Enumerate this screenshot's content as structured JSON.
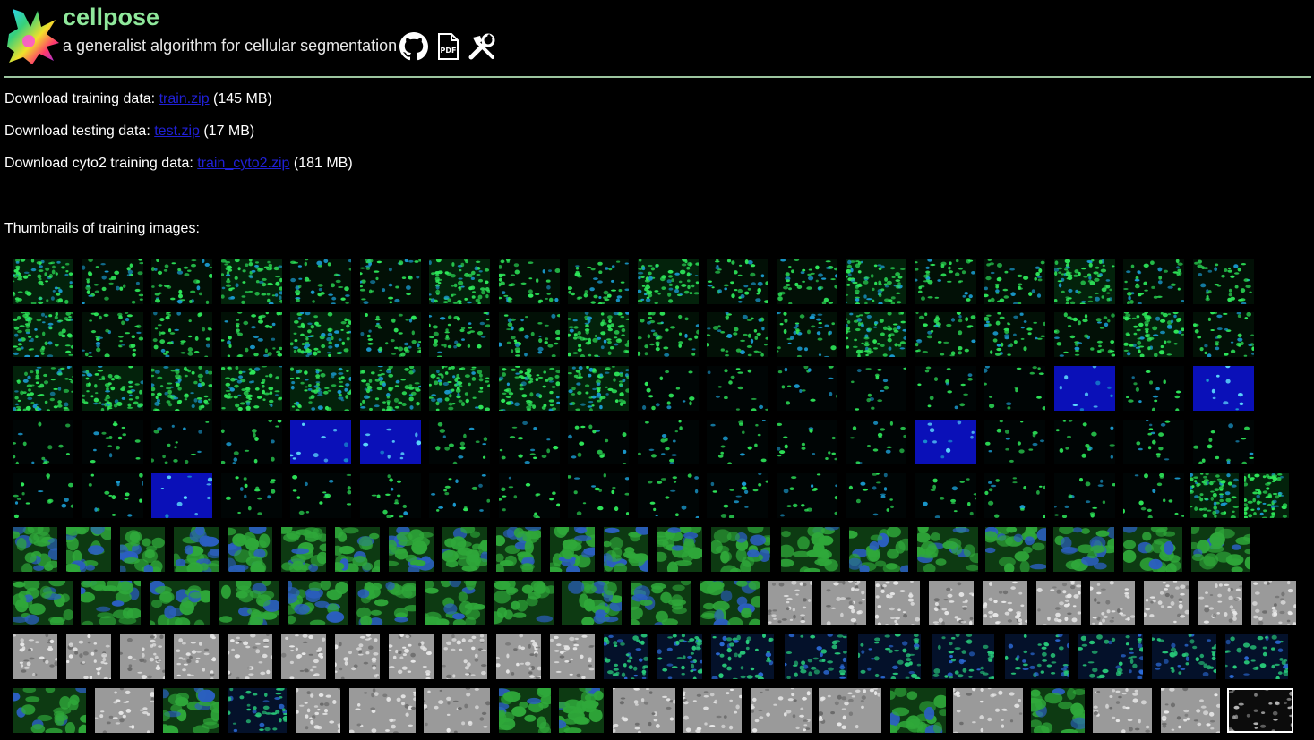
{
  "header": {
    "title": "cellpose",
    "subtitle": "a generalist algorithm for cellular segmentation",
    "icons": [
      "github-icon",
      "pdf-icon",
      "tools-icon"
    ],
    "pdf_icon_text": "PDF"
  },
  "downloads": [
    {
      "label": "Download training data: ",
      "link": "train.zip",
      "size": " (145 MB)"
    },
    {
      "label": "Download testing data: ",
      "link": "test.zip",
      "size": " (17 MB)"
    },
    {
      "label": "Download cyto2 training data: ",
      "link": "train_cyto2.zip",
      "size": " (181 MB)"
    }
  ],
  "thumbnails_label": "Thumbnails of training images:",
  "colors": {
    "title": "#8fe89b",
    "link": "#2020d6",
    "rule": "#9cc59f",
    "background": "#000000"
  },
  "thumbnail_styles": [
    "green-sparse",
    "green-dense",
    "blue-background",
    "dense-cytoplasm",
    "grayscale",
    "nuclei-grid",
    "selected-grayscale"
  ],
  "thumbnail_rows": [
    {
      "count": 18,
      "style": "green-sparse"
    },
    {
      "count": 18,
      "style": "green-sparse"
    },
    {
      "count": 18,
      "style": "mixed-blue"
    },
    {
      "count": 18,
      "style": "sparse-dark"
    },
    {
      "count": 18,
      "style": "sparse-dark"
    },
    {
      "count": 22,
      "style": "dense-cytoplasm"
    },
    {
      "count": 22,
      "style": "cytoplasm-then-gray"
    },
    {
      "count": 20,
      "style": "gray-then-nuclei"
    },
    {
      "count": 19,
      "style": "mixed-last-selected"
    }
  ]
}
